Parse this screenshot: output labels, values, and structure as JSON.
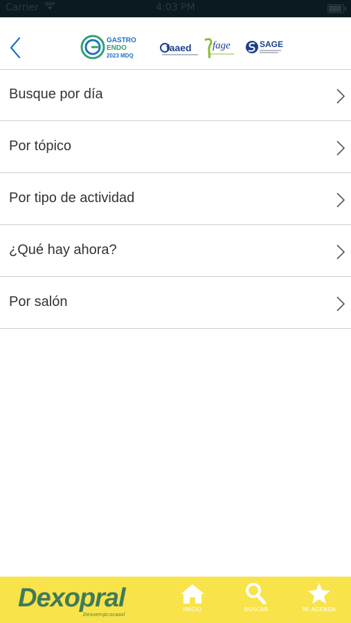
{
  "status_bar": {
    "carrier": "Carrier",
    "time": "4:03 PM",
    "battery_level": 0.9
  },
  "header": {
    "logos": {
      "gastro_endo_line1": "GASTRO",
      "gastro_endo_line2": "ENDO",
      "gastro_endo_line3": "2023 MDQ",
      "faaed": "faaed",
      "fage": "fage",
      "sage": "SAGE"
    }
  },
  "menu": {
    "items": [
      {
        "label": "Busque por día"
      },
      {
        "label": "Por tópico"
      },
      {
        "label": "Por tipo de actividad"
      },
      {
        "label": "¿Qué hay ahora?"
      },
      {
        "label": "Por salón"
      }
    ]
  },
  "tabbar": {
    "brand": "Dexopral",
    "brand_sub": "Dexoempr.ocasol",
    "tabs": [
      {
        "label": "INICIO",
        "icon": "home-icon"
      },
      {
        "label": "BUSCAR",
        "icon": "search-icon"
      },
      {
        "label": "MI AGENDA",
        "icon": "star-icon"
      }
    ]
  },
  "colors": {
    "accent": "#1e6fc7",
    "tabbar": "#f8e34a",
    "brand": "#3f7a5c",
    "divider": "#cfcfcf"
  }
}
